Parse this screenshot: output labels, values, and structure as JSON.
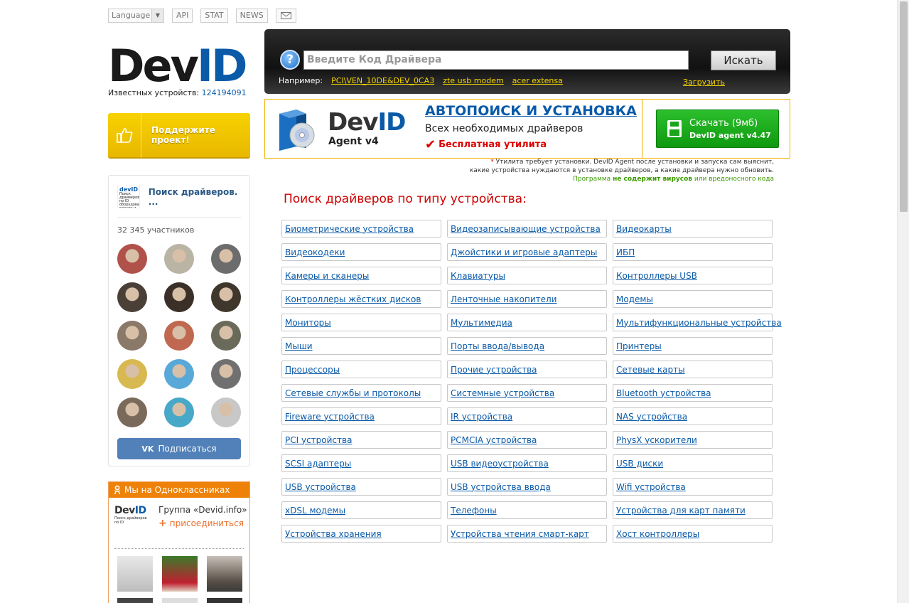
{
  "topbar": {
    "language": "Language",
    "api": "API",
    "stat": "STAT",
    "news": "NEWS"
  },
  "logo": {
    "dev": "Dev",
    "id": "ID"
  },
  "known": {
    "label": "Известных устройств:",
    "count": "124194091"
  },
  "support": {
    "label": "Поддержите проект!"
  },
  "vk": {
    "group_name": "Поиск драйверов. ...",
    "avatar_text": "Поиск драйверов по ID оборудования, версии и ...",
    "avatar_logo": "devID",
    "members": "32 345 участников",
    "subscribe": "Подписаться",
    "vk_logo": "VK",
    "face_colors": [
      "#b0524a",
      "#b9b4a3",
      "#6c6c6c",
      "#4a4038",
      "#3b3028",
      "#3f372c",
      "#8a7868",
      "#c06850",
      "#6a6a5a",
      "#d8b850",
      "#58a8d8",
      "#707070",
      "#7a6a5a",
      "#48a8c8",
      "#c8c8c8"
    ]
  },
  "ok": {
    "header": "Мы на Одноклассниках",
    "group_title": "Группа «Devid.info»",
    "join": "присоединиться",
    "logo_dev": "Dev",
    "logo_id": "ID",
    "logo_sub": "Поиск драйверов по ID"
  },
  "search": {
    "placeholder": "Введите Код Драйвера",
    "button": "Искать",
    "example_label": "Например:",
    "examples": [
      "PCI\\VEN_10DE&DEV_0CA3",
      "zte usb modem",
      "acer extensa"
    ],
    "upload": "Загрузить"
  },
  "promo": {
    "name_dev": "Dev",
    "name_id": "ID",
    "version": "Agent v4",
    "title": "АВТОПОИСК И УСТАНОВКА",
    "description": "Всех необходимых драйверов",
    "free": "Бесплатная утилита",
    "download_label": "Скачать (9мб)",
    "download_version": "DevID agent v4.47"
  },
  "note": {
    "star": "*",
    "line1": "Утилита требует установки. DevID Agent после установки и запуска сам выяснит,",
    "line2": "какие устройства нуждаются в установке драйверов, а какие драйвера нужно обновить.",
    "line3_pre": "Программа",
    "line3_bold": "не содержит вирусов",
    "line3_post": "или вредоносного кода"
  },
  "categories": {
    "title": "Поиск драйверов по типу устройства:",
    "items": [
      "Биометрические устройства",
      "Видеозаписывающие устройства",
      "Видеокарты",
      "Видеокодеки",
      "Джойстики и игровые адаптеры",
      "ИБП",
      "Камеры и сканеры",
      "Клавиатуры",
      "Контроллеры USB",
      "Контроллеры жёстких дисков",
      "Ленточные накопители",
      "Модемы",
      "Мониторы",
      "Мультимедиа",
      "Мультифункциональные устройства",
      "Мыши",
      "Порты ввода/вывода",
      "Принтеры",
      "Процессоры",
      "Прочие устройства",
      "Сетевые карты",
      "Сетевые службы и протоколы",
      "Системные устройства",
      "Bluetooth устройства",
      "Fireware устройства",
      "IR устройства",
      "NAS устройства",
      "PCI устройства",
      "PCMCIA устройства",
      "PhysX ускорители",
      "SCSI адаптеры",
      "USB видеоустройства",
      "USB диски",
      "USB устройства",
      "USB устройства ввода",
      "Wifi устройства",
      "xDSL модемы",
      "Телефоны",
      "Устройства для карт памяти",
      "Устройства хранения",
      "Устройства чтения смарт-карт",
      "Хост контроллеры"
    ]
  }
}
